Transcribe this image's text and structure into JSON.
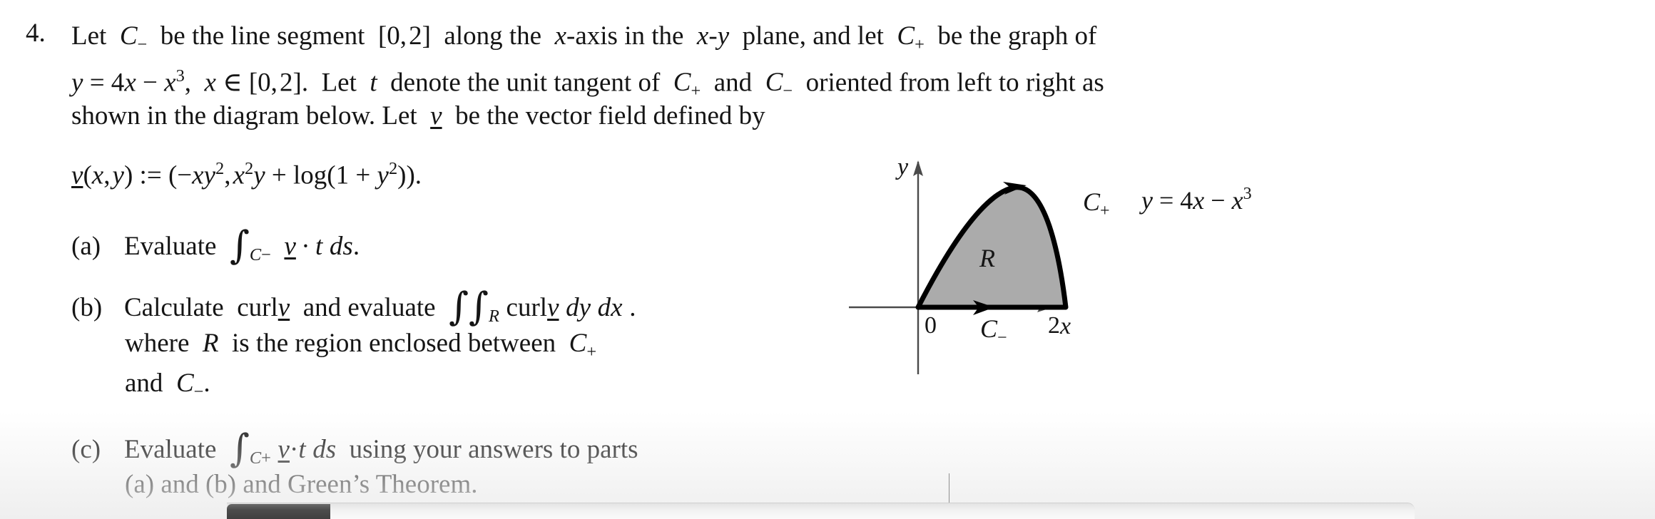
{
  "problem": {
    "number": "4.",
    "lead_line_1": "Let C₋ be the line segment [0, 2] along the x-axis in the x-y plane, and let C₊ be the graph of",
    "lead_line_2": "y = 4x − x³, x ∈ [0, 2]. Let t denote the unit tangent of C₊ and C₋ oriented from left to right as",
    "lead_line_3": "shown in the diagram below. Let v be the vector field defined by",
    "display_equation": "v(x, y) := (−xy², x²y + log(1 + y²)).",
    "parts": [
      {
        "label": "(a)",
        "line_1": "Evaluate ∫_{C₋} v · t ds.",
        "line_2": "",
        "line_3": ""
      },
      {
        "label": "(b)",
        "line_1": "Calculate curl v and evaluate ∫∫_R curl v dy dx .",
        "line_2": "where R is the region enclosed between C₊",
        "line_3": "and C₋."
      },
      {
        "label": "(c)",
        "line_1": "Evaluate ∫_{C₊} v·t ds using your answers to parts",
        "line_2": "(a) and (b) and Green’s Theorem.",
        "line_3": ""
      }
    ],
    "tokens": {
      "let": "Let",
      "be_line_seg": "be the line segment",
      "along_axis": "along the",
      "axis_word": "-axis in the",
      "plane_and_let": "plane, and let",
      "be_graph_of": "be the graph of",
      "let2": "Let",
      "denote_unit_tangent": "denote the unit tangent of",
      "and_word": "and",
      "oriented": "oriented from left to right as",
      "shown_line": "shown in the diagram below. Let",
      "be_vector_field": "be the vector field defined by",
      "evaluate": "Evaluate",
      "calculate": "Calculate",
      "curl": "curl",
      "and_evaluate": "and evaluate",
      "where": "where",
      "is_region": "is the region enclosed between",
      "and_end": "and",
      "using_answers": "using your answers to parts",
      "greens": "(a) and (b) and Green’s Theorem.",
      "log": "log",
      "ds": "ds",
      "dydx_dy": "dy",
      "dydx_dx": "dx"
    }
  },
  "diagram": {
    "axis_label_y": "y",
    "axis_label_x": "x",
    "tick_0": "0",
    "tick_2": "2",
    "region_label": "R",
    "curve_label": "C₊",
    "segment_label": "C₋",
    "equation_label": "y = 4x − x³",
    "fill_color": "#ABABAB",
    "stroke_color": "#000000",
    "axis_color": "#4a4a4a"
  },
  "chart_data": {
    "type": "line",
    "title": "",
    "xlabel": "x",
    "ylabel": "y",
    "xlim": [
      -0.35,
      2.6
    ],
    "ylim": [
      -0.55,
      3.6
    ],
    "grid": false,
    "legend": "none",
    "series": [
      {
        "name": "C+",
        "equation": "y = 4x - x^3",
        "domain": [
          0,
          2
        ],
        "x": [
          0,
          0.2,
          0.4,
          0.6,
          0.8,
          1.0,
          1.1547,
          1.2,
          1.4,
          1.6,
          1.8,
          2.0
        ],
        "y": [
          0,
          0.792,
          1.536,
          2.184,
          2.688,
          3.0,
          3.0792,
          3.072,
          2.856,
          2.304,
          1.368,
          0.0
        ]
      },
      {
        "name": "C-",
        "equation": "y = 0",
        "domain": [
          0,
          2
        ],
        "x": [
          0,
          2
        ],
        "y": [
          0,
          0
        ]
      }
    ],
    "annotations": [
      {
        "text": "R",
        "x": 0.85,
        "y": 1.15
      },
      {
        "text": "C+",
        "x": 2.15,
        "y": 1.95
      },
      {
        "text": "C-",
        "x": 1.0,
        "y": -0.35
      },
      {
        "text": "y = 4x - x^3",
        "x": 2.6,
        "y": 1.95
      }
    ],
    "arrows": [
      {
        "on": "C+",
        "at_x": 1.1547,
        "direction": "right"
      },
      {
        "on": "C-",
        "at_x": 1.0,
        "direction": "right"
      }
    ],
    "ticks": {
      "x": [
        0,
        2
      ],
      "y": []
    }
  },
  "scrollbar": {
    "orientation": "horizontal",
    "thumb_position": "left"
  }
}
